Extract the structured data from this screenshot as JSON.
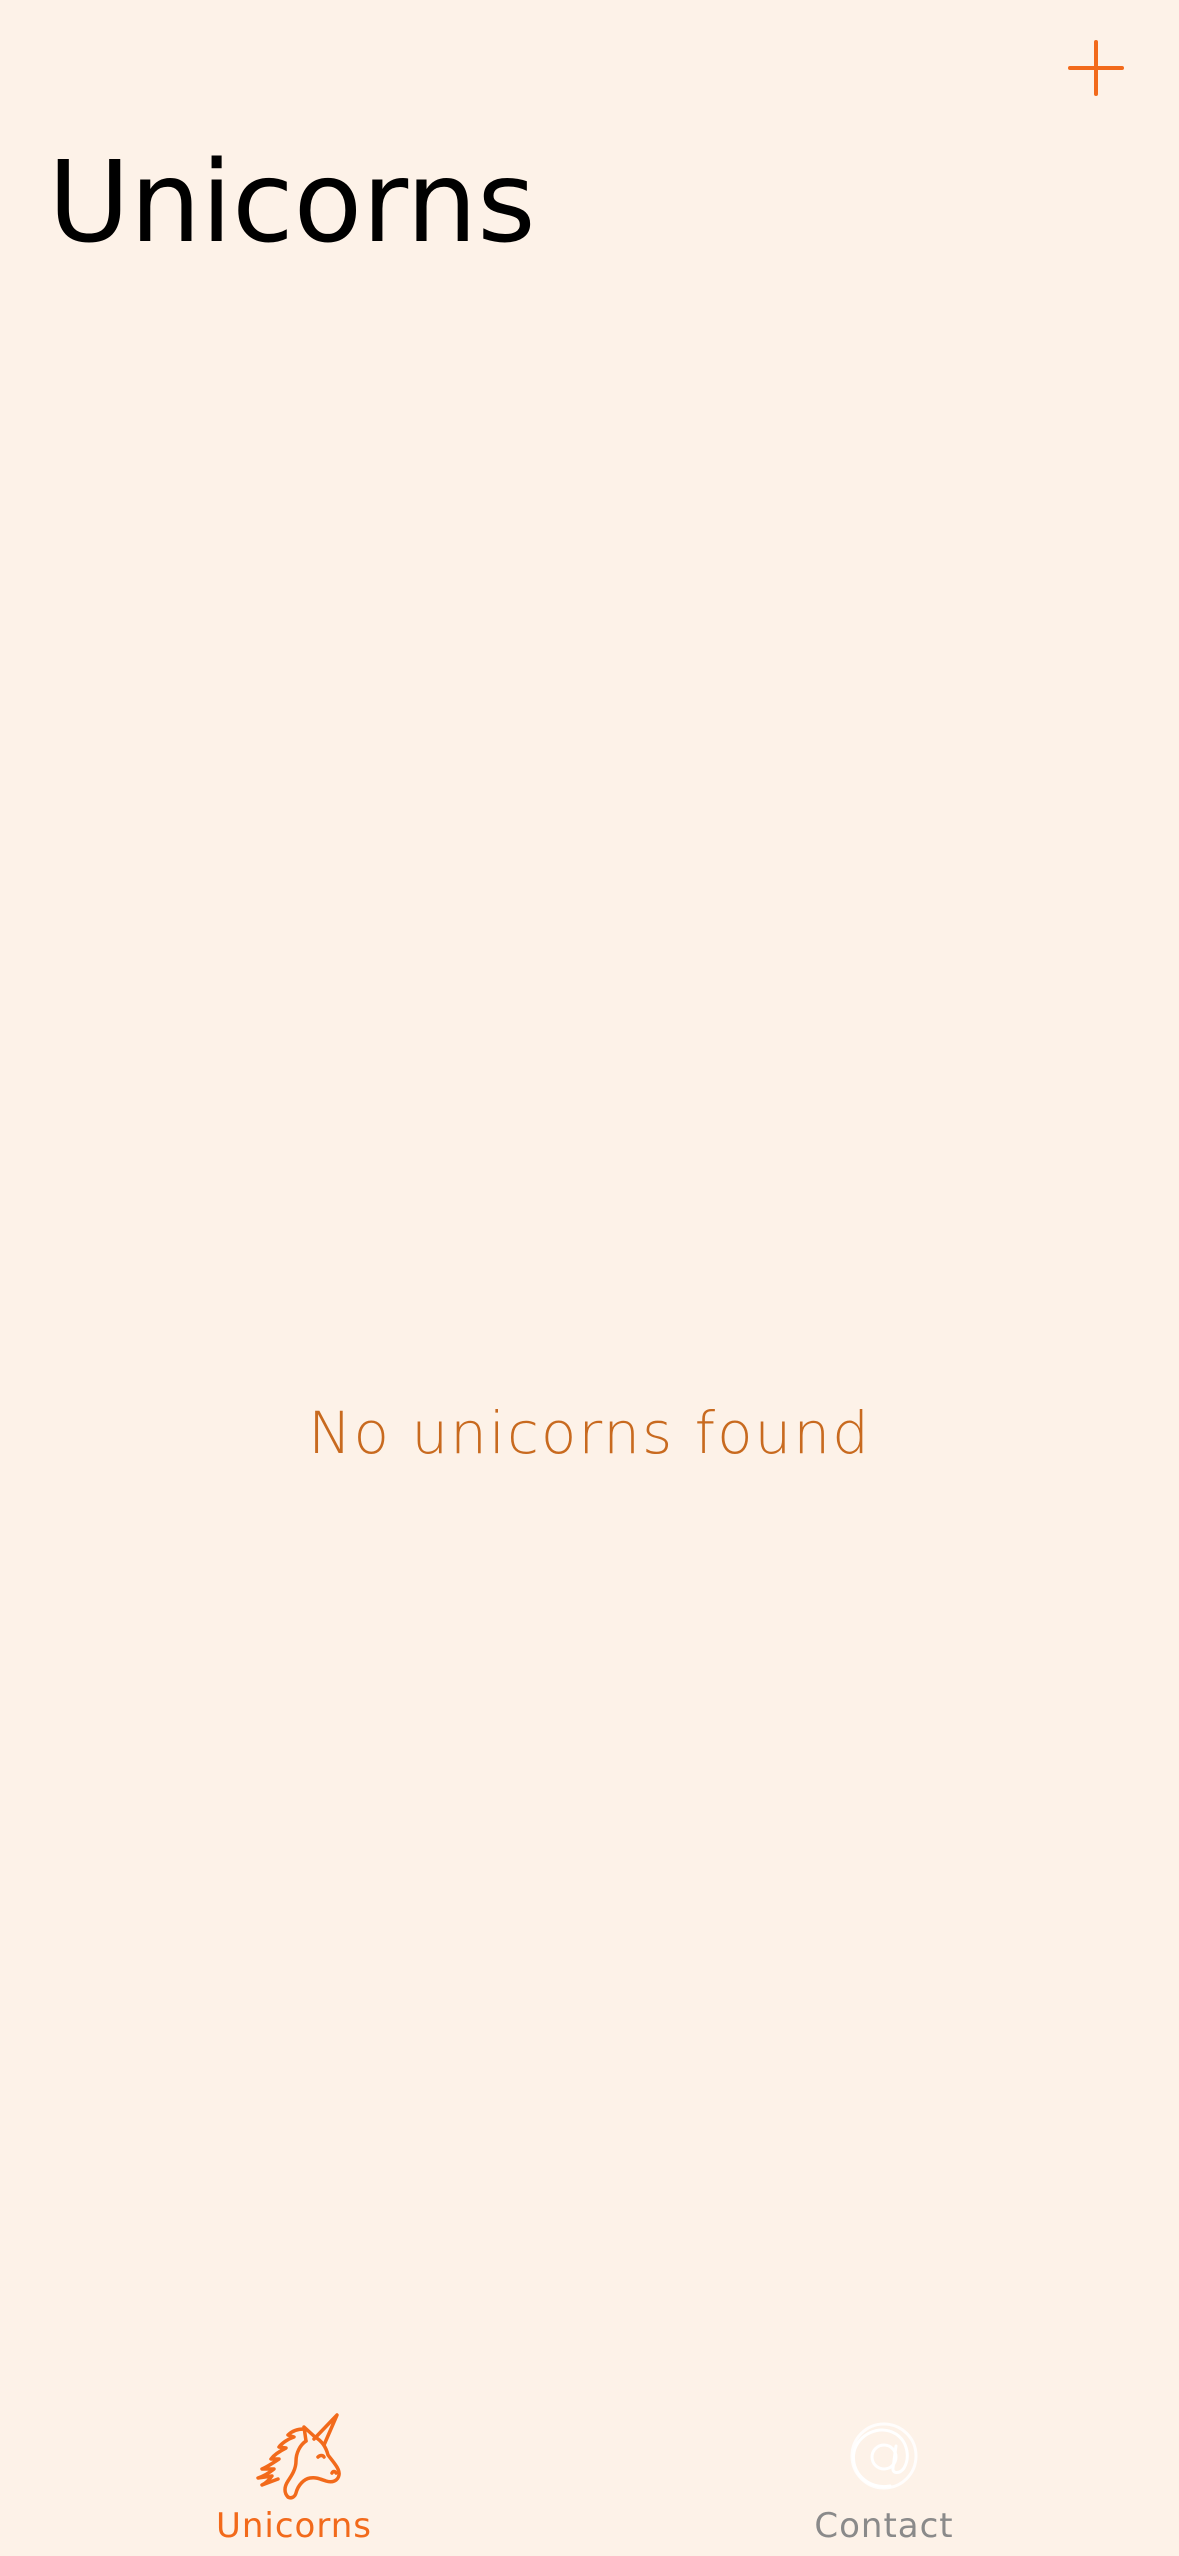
{
  "header": {
    "title": "Unicorns",
    "add_icon": "plus-icon"
  },
  "main": {
    "empty_message": "No unicorns found"
  },
  "tabs": [
    {
      "label": "Unicorns",
      "icon": "unicorn-icon",
      "active": true
    },
    {
      "label": "Contact",
      "icon": "at-sign-icon",
      "active": false
    }
  ],
  "colors": {
    "background": "#fdf2e8",
    "accent": "#f26a1b",
    "empty_text": "#c86a1f",
    "inactive": "#8a8a8a",
    "title": "#000000"
  }
}
